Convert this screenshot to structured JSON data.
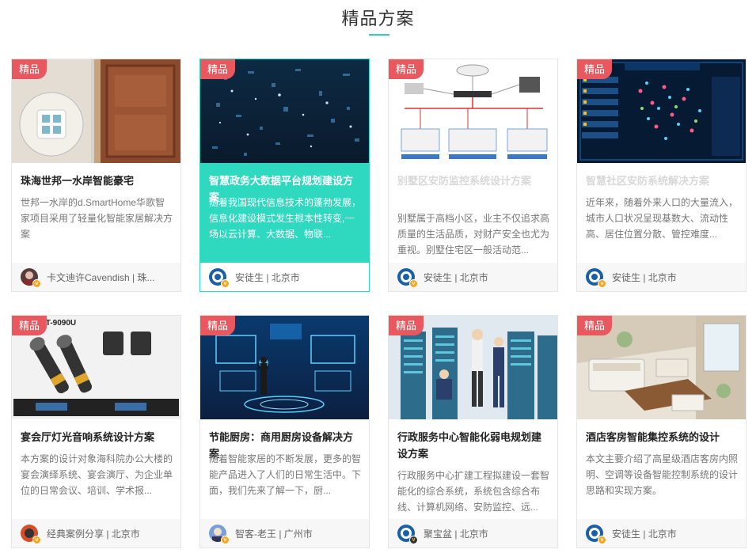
{
  "section": {
    "title": "精品方案"
  },
  "cards": [
    {
      "badge": "精品",
      "title": "珠海世邦一水岸智能豪宅",
      "desc": "世邦一水岸的d.SmartHome华歌智家项目采用了轻量化智能家居解决方案",
      "author": "卡文迪许Cavendish | 珠...",
      "image": "smart-switch-panel-photo"
    },
    {
      "badge": "精品",
      "title": "智慧政务大数据平台规划建设方案",
      "desc": "随着我国现代信息技术的蓬勃发展，信息化建设模式发生根本性转变,一场以云计算、大数据、物联...",
      "author": "安徒生 | 北京市",
      "image": "digital-data-stream-photo"
    },
    {
      "badge": "精品",
      "title": "别墅区安防监控系统设计方案",
      "desc": "别墅属于高档小区，业主不仅追求高质量的生活品质，对财产安全也尤为重视。别墅住宅区一般活动范...",
      "author": "安徒生 | 北京市",
      "image": "network-topology-diagram"
    },
    {
      "badge": "精品",
      "title": "智慧社区安防系统解决方案",
      "desc": "近年来，随着外来人口的大量流入，城市人口状况呈现基数大、流动性高、居住位置分散、管控难度...",
      "author": "安徒生 | 北京市",
      "image": "security-dashboard-screen"
    },
    {
      "badge": "精品",
      "title": "宴会厅灯光音响系统设计方案",
      "desc": "本方案的设计对象海科院办公大楼的宴会演绎系统、宴会演厅、为企业单位的日常会议、培训、学术报...",
      "author": "经典案例分享 | 北京市",
      "image": "wireless-microphone-photo",
      "image_text": "4CT-9090U"
    },
    {
      "badge": "精品",
      "title": "节能厨房：商用厨房设备解决方案",
      "desc": "随着智能家居的不断发展，更多的智能产品进入了人们的日常生活中。下面，我们先来了解一下，厨...",
      "author": "智客-老王 | 广州市",
      "image": "holographic-interface-photo"
    },
    {
      "badge": "精品",
      "title": "行政服务中心智能化弱电规划建设方案",
      "desc": "行政服务中心扩建工程拟建设一套智能化的综合系统，系统包含综合布线、计算机网络、安防监控、远...",
      "author": "聚宝盆 | 北京市",
      "image": "server-room-illustration"
    },
    {
      "badge": "精品",
      "title": "酒店客房智能集控系统的设计",
      "desc": "本文主要介绍了高星级酒店客房内照明、空调等设备智能控制系统的设计思路和实现方案。",
      "author": "安徒生 | 北京市",
      "image": "hotel-room-render"
    }
  ],
  "colors": {
    "accent": "#2fd0b7",
    "badge": "#e8585e",
    "active_card": "#2fd9c0"
  }
}
